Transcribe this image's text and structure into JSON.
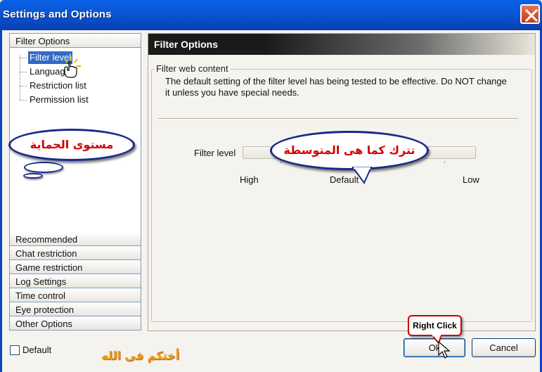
{
  "window": {
    "title": "Settings and Options"
  },
  "sidebar": {
    "top_section": "Filter Options",
    "tree_items": [
      {
        "label": "Filter level",
        "selected": true
      },
      {
        "label": "Language",
        "selected": false
      },
      {
        "label": "Restriction list",
        "selected": false
      },
      {
        "label": "Permission list",
        "selected": false
      }
    ],
    "sections": [
      "Recommended",
      "Chat restriction",
      "Game restriction",
      "Log Settings",
      "Time control",
      "Eye protection",
      "Other Options"
    ]
  },
  "main": {
    "header": "Filter Options",
    "group_title": "Filter web content",
    "description": "The default setting of the filter level has being tested to be effective. Do NOT change it unless you have special needs.",
    "slider": {
      "label": "Filter level",
      "value_position": 0.5,
      "labels": {
        "high": "High",
        "default": "Default",
        "low": "Low"
      }
    }
  },
  "footer": {
    "default_checkbox_label": "Default",
    "default_checked": false,
    "ok_label": "Ok",
    "cancel_label": "Cancel"
  },
  "annotations": {
    "protection_level": "مستوى الحماية",
    "keep_default": "تترك كما هى المتوسطة",
    "right_click": "Right Click",
    "signature": "أختكم فى الله"
  },
  "colors": {
    "titlebar": "#0846bd",
    "selection": "#316ac5",
    "annotation_text": "#d40000",
    "bubble_border": "#1a2a8a"
  }
}
